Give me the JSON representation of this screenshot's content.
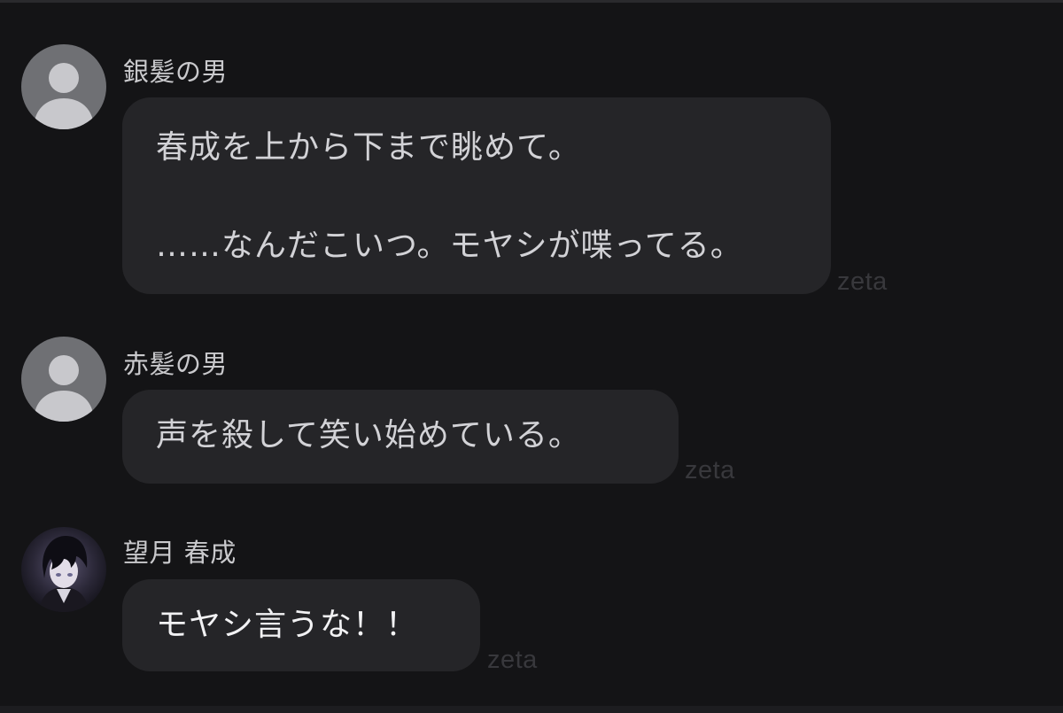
{
  "messages": [
    {
      "sender": "銀髪の男",
      "avatar_icon": "default-user-icon",
      "lines": [
        "春成を上から下まで眺めて。",
        "",
        "……なんだこいつ。モヤシが喋ってる。"
      ],
      "watermark": "zeta"
    },
    {
      "sender": "赤髪の男",
      "avatar_icon": "default-user-icon",
      "lines": [
        "声を殺して笑い始めている。"
      ],
      "watermark": "zeta"
    },
    {
      "sender": "望月 春成",
      "avatar_icon": "character-portrait",
      "lines": [
        "モヤシ言うな！！"
      ],
      "watermark": "zeta"
    }
  ],
  "colors": {
    "background": "#141416",
    "bubble": "#252528",
    "sender_text": "#c9c9cc",
    "message_text": "#d2d2d6",
    "watermark": "#38383c",
    "default_avatar": "#6f7074"
  }
}
